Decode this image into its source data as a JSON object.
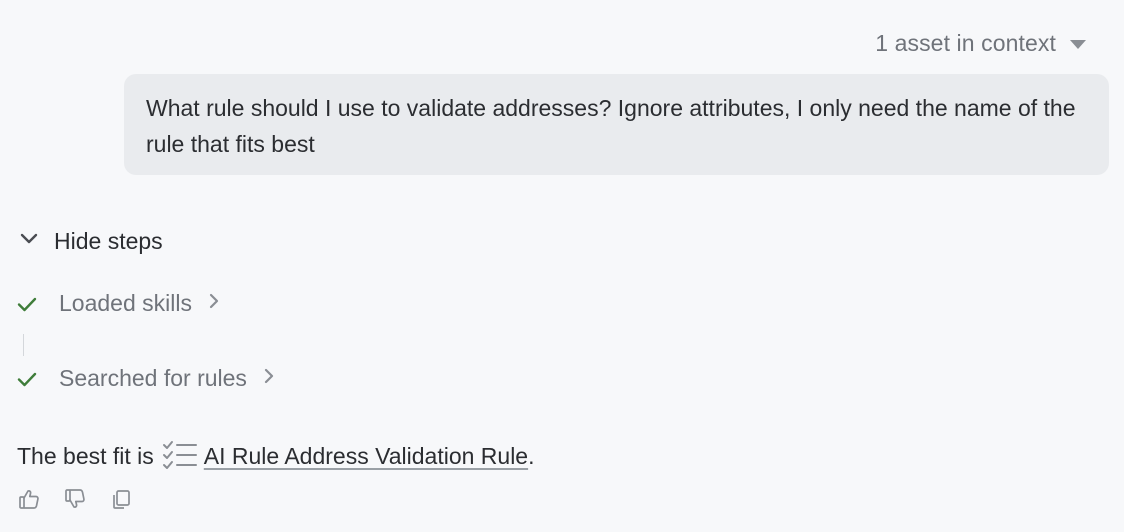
{
  "context": {
    "label": "1 asset in context",
    "caret_icon": "caret-down-icon"
  },
  "user_message": {
    "text": "What rule should I use to validate addresses? Ignore attributes, I only need the name of the rule that fits best"
  },
  "steps_toggle": {
    "label": "Hide steps",
    "icon": "chevron-down-icon"
  },
  "steps": [
    {
      "label": "Loaded skills",
      "status": "done",
      "status_icon": "check-icon",
      "expand_icon": "chevron-right-icon"
    },
    {
      "label": "Searched for rules",
      "status": "done",
      "status_icon": "check-icon",
      "expand_icon": "chevron-right-icon"
    }
  ],
  "answer": {
    "prefix": "The best fit is",
    "rule_icon": "rule-checklist-icon",
    "rule_name": "AI Rule Address Validation Rule",
    "suffix": "."
  },
  "actions": [
    {
      "name": "thumbs-up-icon"
    },
    {
      "name": "thumbs-down-icon"
    },
    {
      "name": "copy-icon"
    }
  ],
  "colors": {
    "background": "#f7f8fa",
    "bubble": "#e9ebee",
    "text": "#2b2d31",
    "muted_text": "#6f737a",
    "check_green": "#3f7d3a",
    "icon_gray": "#8a8e94"
  }
}
